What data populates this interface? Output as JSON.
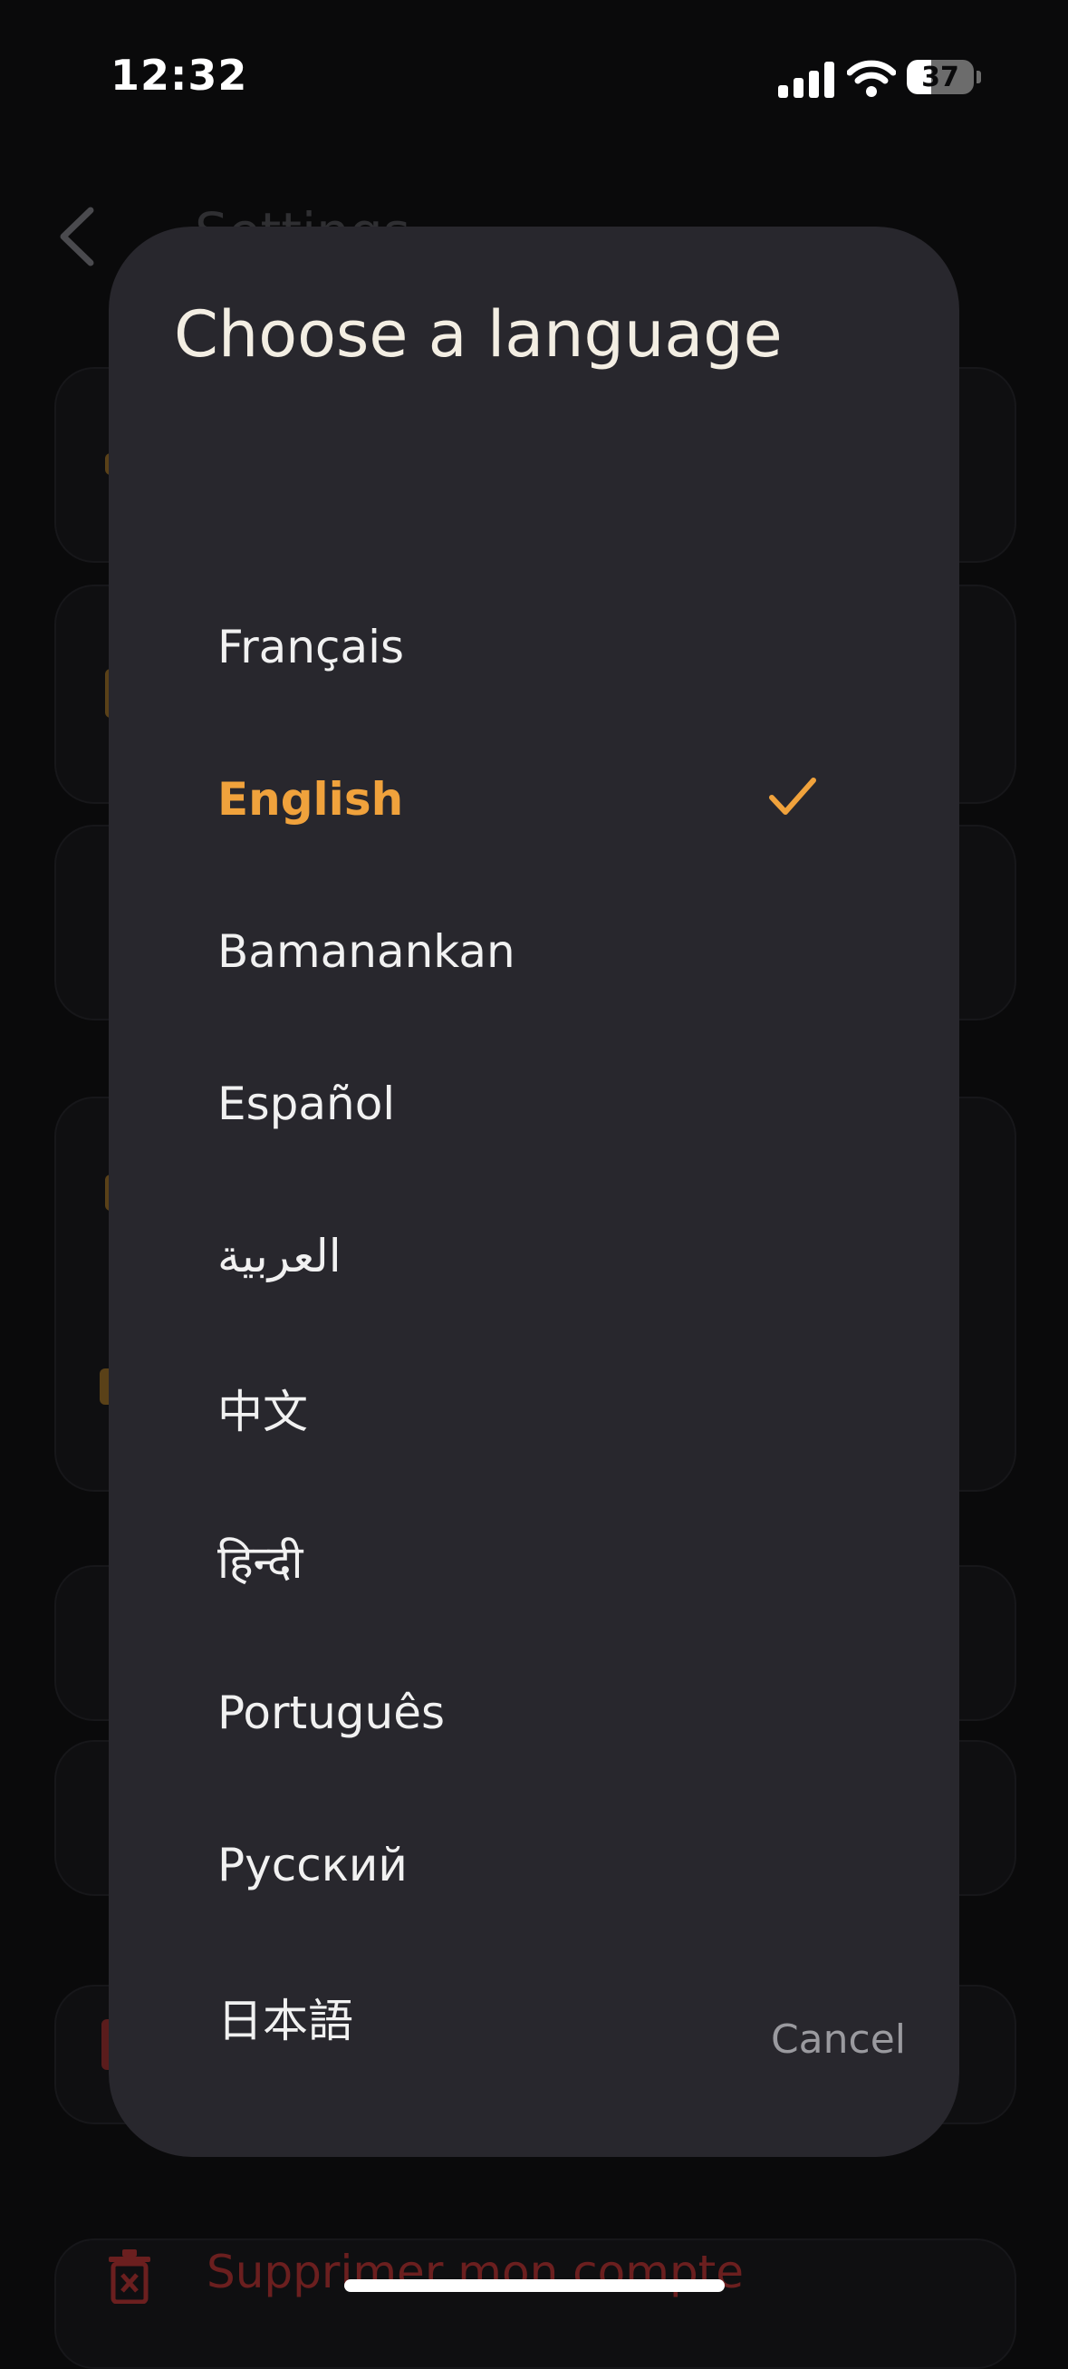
{
  "status_bar": {
    "time": "12:32",
    "battery_level": "37",
    "icons": [
      "cellular-signal-icon",
      "wifi-icon",
      "battery-icon"
    ]
  },
  "background_page": {
    "title": "Settings",
    "delete_account_label": "Supprimer mon compte"
  },
  "dialog": {
    "title": "Choose a language",
    "languages": [
      {
        "label": "Français",
        "selected": false
      },
      {
        "label": "English",
        "selected": true
      },
      {
        "label": "Bamanankan",
        "selected": false
      },
      {
        "label": "Español",
        "selected": false
      },
      {
        "label": "العربية",
        "selected": false
      },
      {
        "label": "中文",
        "selected": false
      },
      {
        "label": "हिन्दी",
        "selected": false
      },
      {
        "label": "Português",
        "selected": false
      },
      {
        "label": "Русский",
        "selected": false
      },
      {
        "label": "日本語",
        "selected": false
      }
    ],
    "cancel_label": "Cancel"
  },
  "colors": {
    "accent": "#f0a23c",
    "dialog_bg": "#28272d",
    "screen_bg": "#0a0a0b",
    "destructive": "#6b1f1f"
  }
}
